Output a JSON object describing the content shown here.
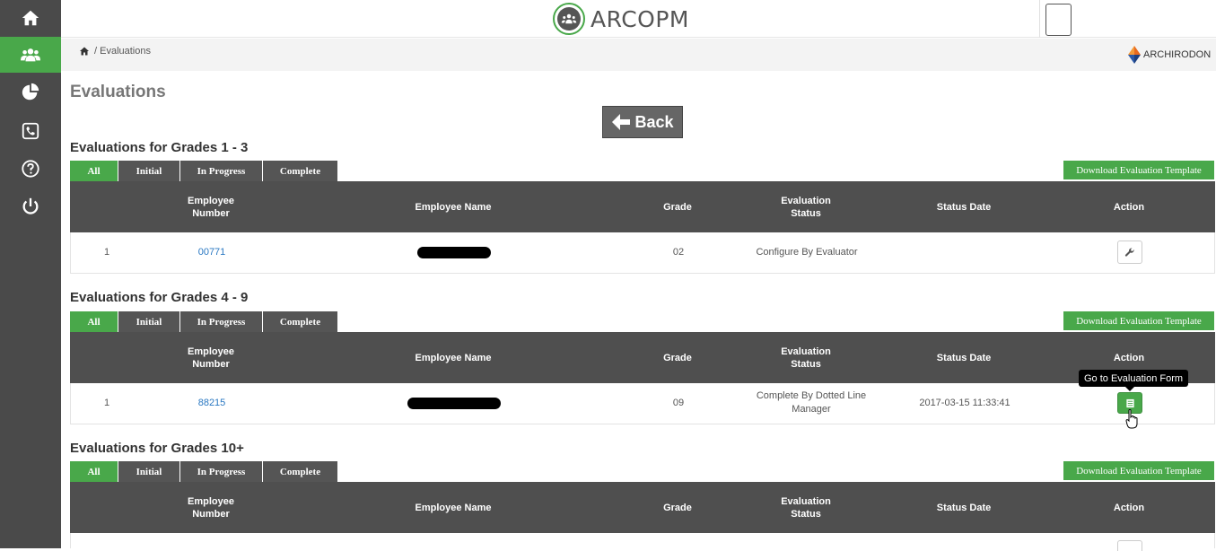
{
  "app": {
    "logo_text": "ARCOPM",
    "brand_text": "ARCHIRODON"
  },
  "breadcrumb": "/ Evaluations",
  "page_title": "Evaluations",
  "back_label": "Back",
  "sidebar": {
    "items": [
      {
        "icon": "home-icon"
      },
      {
        "icon": "users-icon",
        "active": true
      },
      {
        "icon": "pie-chart-icon"
      },
      {
        "icon": "phone-icon"
      },
      {
        "icon": "help-icon"
      },
      {
        "icon": "power-icon"
      }
    ]
  },
  "tab_labels": {
    "all": "All",
    "initial": "Initial",
    "in_progress": "In Progress",
    "complete": "Complete"
  },
  "download_label": "Download Evaluation Template",
  "columns": {
    "emp_num": "Employee Number",
    "emp_name": "Employee Name",
    "grade": "Grade",
    "eval_status": "Evaluation Status",
    "status_date": "Status Date",
    "action": "Action"
  },
  "sections": [
    {
      "title": "Evaluations for Grades 1 - 3",
      "rows": [
        {
          "idx": "1",
          "emp_num": "00771",
          "grade": "02",
          "status": "Configure By Evaluator",
          "status_date": "",
          "action_icon": "wrench-icon"
        }
      ]
    },
    {
      "title": "Evaluations for Grades 4 - 9",
      "rows": [
        {
          "idx": "1",
          "emp_num": "88215",
          "grade": "09",
          "status": "Complete By Dotted Line Manager",
          "status_date": "2017-03-15 11:33:41",
          "action_icon": "form-icon"
        }
      ]
    },
    {
      "title": "Evaluations for Grades 10+",
      "rows": []
    }
  ],
  "tooltip": "Go to Evaluation Form",
  "colors": {
    "green": "#49a84a",
    "sidebar": "#4a4a4a",
    "header": "#4f4f4f"
  }
}
